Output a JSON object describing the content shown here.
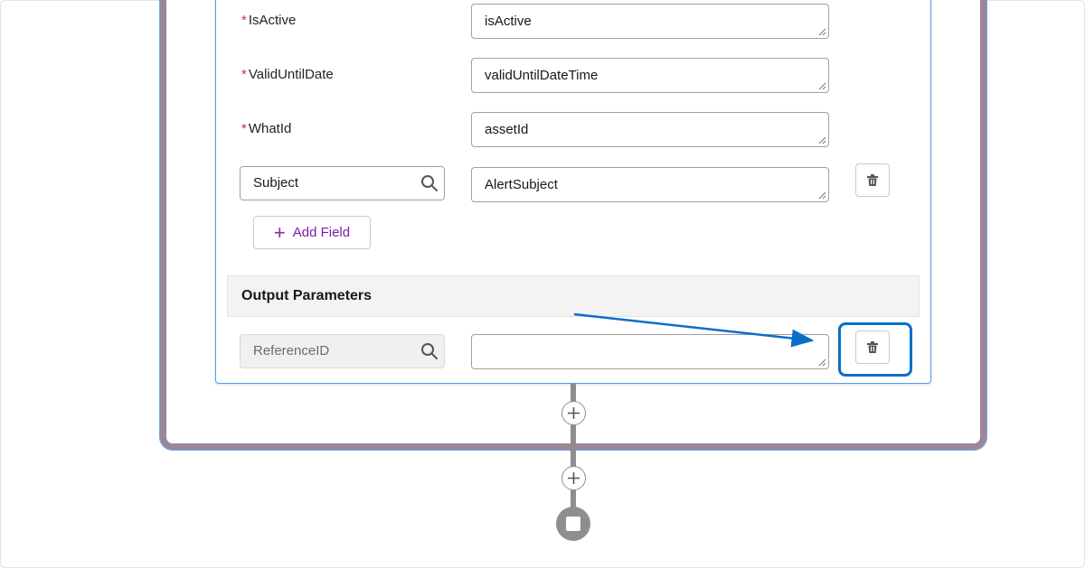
{
  "input_fields": [
    {
      "name": "IsActive",
      "required": true,
      "value": "isActive"
    },
    {
      "name": "ValidUntilDate",
      "required": true,
      "value": "validUntilDateTime"
    },
    {
      "name": "WhatId",
      "required": true,
      "value": "assetId"
    }
  ],
  "required_marker": "*",
  "custom_field": {
    "field_name": "Subject",
    "value": "AlertSubject"
  },
  "add_field_label": "Add Field",
  "output_section": {
    "title": "Output Parameters",
    "field_name": "ReferenceID",
    "value": ""
  },
  "colors": {
    "accent": "#0b6fc9",
    "required": "#c23934",
    "add_field": "#7b1fa2",
    "frame": "#9b8698",
    "connector": "#8e8e8e"
  },
  "icons": {
    "search": "search-icon",
    "delete": "trash-icon",
    "add": "plus-icon",
    "end": "stop-icon"
  }
}
